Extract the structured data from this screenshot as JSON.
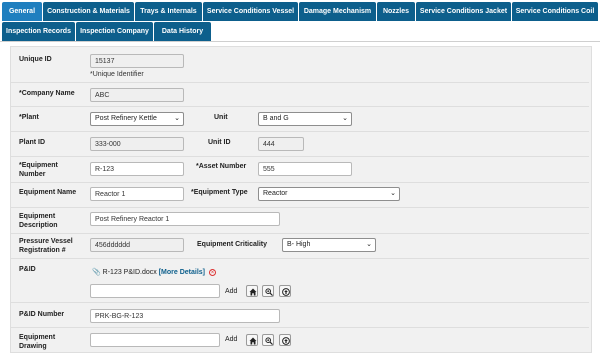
{
  "tabs_row1": [
    "General",
    "Construction & Materials",
    "Trays & Internals",
    "Service Conditions Vessel",
    "Damage Mechanism",
    "Nozzles",
    "Service Conditions Jacket",
    "Service Conditions Coil"
  ],
  "tabs_row2": [
    "Inspection Records",
    "Inspection Company",
    "Data History"
  ],
  "active_tab": "General",
  "form": {
    "unique_id_label": "Unique ID",
    "unique_id_value": "15137",
    "unique_id_hint": "*Unique Identifier",
    "company_label": "*Company Name",
    "company_value": "ABC",
    "plant_label": "*Plant",
    "plant_value": "Post Refinery Kettle",
    "unit_label": "Unit",
    "unit_value": "B and G",
    "plant_id_label": "Plant ID",
    "plant_id_value": "333-000",
    "unit_id_label": "Unit ID",
    "unit_id_value": "444",
    "equipment_number_label": "*Equipment Number",
    "equipment_number_value": "R-123",
    "asset_number_label": "*Asset Number",
    "asset_number_value": "555",
    "equipment_name_label": "Equipment Name",
    "equipment_name_value": "Reactor 1",
    "equipment_type_label": "*Equipment Type",
    "equipment_type_value": "Reactor",
    "equipment_description_label": "Equipment Description",
    "equipment_description_value": "Post Refinery Reactor 1",
    "pv_registration_label": "Pressure Vessel Registration #",
    "pv_registration_value": "456dddddd",
    "criticality_label": "Equipment Criticality",
    "criticality_value": "B- High",
    "pid_label": "P&ID",
    "pid_file": "R-123 P&ID.docx",
    "pid_more": "[More Details]",
    "add_label": "Add",
    "pid_number_label": "P&ID Number",
    "pid_number_value": "PRK-BG-R-123",
    "equipment_drawing_label": "Equipment Drawing"
  },
  "icons": [
    "home-icon",
    "zoom-icon",
    "upload-icon",
    "paperclip-icon",
    "remove-icon",
    "chevron-down-icon"
  ]
}
